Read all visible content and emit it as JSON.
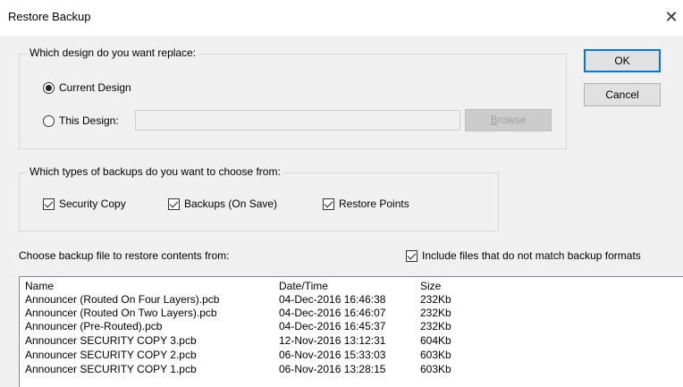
{
  "window": {
    "title": "Restore Backup",
    "close_icon": "close-icon"
  },
  "design_group": {
    "legend": "Which design do you want replace:",
    "option_current": "Current Design",
    "option_this": "This Design:",
    "this_design_value": "",
    "browse_label_prefix": "",
    "browse_label_accel": "B",
    "browse_label_rest": "rowse"
  },
  "buttons": {
    "ok": "OK",
    "cancel": "Cancel"
  },
  "types_group": {
    "legend": "Which types of backups do you want to choose from:",
    "security_copy": "Security Copy",
    "backups_on_save": "Backups (On Save)",
    "restore_points": "Restore Points"
  },
  "file_section": {
    "label": "Choose backup file to restore contents from:",
    "include_nonmatching": "Include files that do not match backup formats"
  },
  "file_list": {
    "columns": [
      "Name",
      "Date/Time",
      "Size"
    ],
    "rows": [
      [
        "Announcer (Routed On  Four Layers).pcb",
        "04-Dec-2016  16:46:38",
        "232Kb"
      ],
      [
        "Announcer (Routed On Two Layers).pcb",
        "04-Dec-2016  16:46:07",
        "232Kb"
      ],
      [
        "Announcer (Pre-Routed).pcb",
        "04-Dec-2016  16:45:37",
        "232Kb"
      ],
      [
        "Announcer SECURITY COPY 3.pcb",
        "12-Nov-2016  13:12:31",
        "604Kb"
      ],
      [
        "Announcer SECURITY COPY 2.pcb",
        "06-Nov-2016  15:33:03",
        "603Kb"
      ],
      [
        "Announcer SECURITY COPY 1.pcb",
        "06-Nov-2016  13:28:15",
        "603Kb"
      ]
    ]
  }
}
